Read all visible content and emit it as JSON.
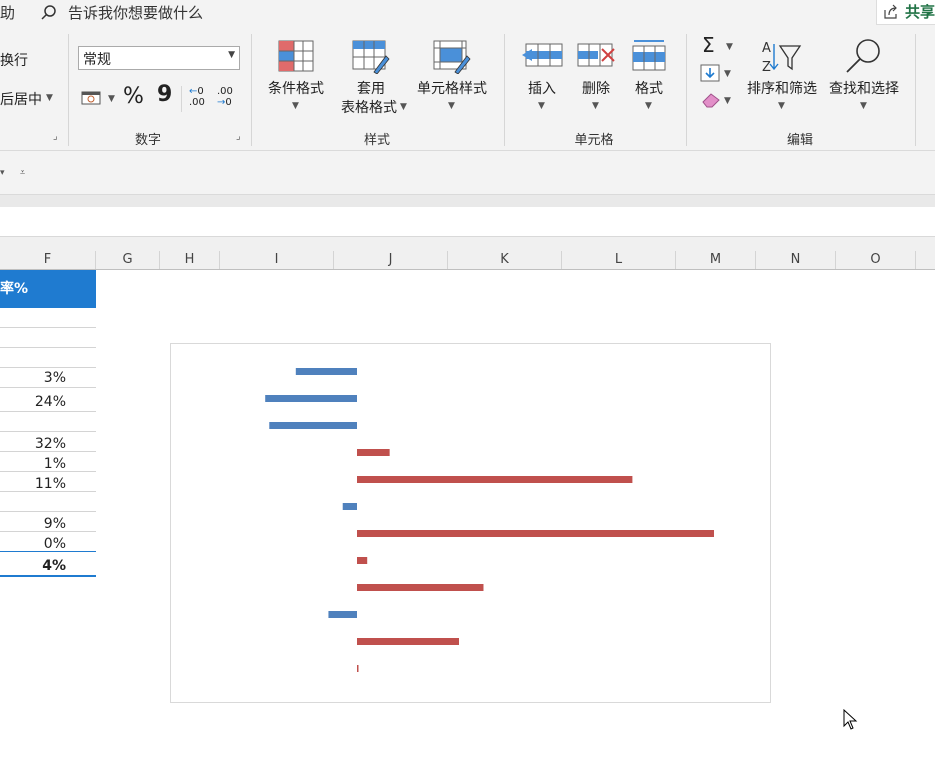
{
  "ribbon": {
    "tell_me": "告诉我你想要做什么",
    "cut_tab_text": "助",
    "share": "共享",
    "alignment": {
      "wrap": "换行",
      "merge": "后居中"
    },
    "number": {
      "format": "常规",
      "percent": "%",
      "comma": "9",
      "inc_decimal": ".00",
      "dec_decimal": ".00",
      "group": "数字"
    },
    "styles": {
      "conditional": "条件格式",
      "table_l1": "套用",
      "table_l2": "表格格式",
      "cell_styles": "单元格样式",
      "group": "样式"
    },
    "cells": {
      "insert": "插入",
      "delete": "删除",
      "format": "格式",
      "group": "单元格"
    },
    "editing": {
      "sum": "Σ",
      "sort_filter": "排序和筛选",
      "find_select": "查找和选择",
      "group": "编辑"
    }
  },
  "columns": [
    "F",
    "G",
    "H",
    "I",
    "J",
    "K",
    "L",
    "M",
    "N",
    "O"
  ],
  "sheet": {
    "header_cell": "率%",
    "values": [
      "3%",
      "24%",
      "32%",
      "1%",
      "11%",
      "9%",
      "0%"
    ],
    "total": "4%"
  },
  "colors": {
    "accent": "#1f7bd0",
    "negative_bar": "#4f81bd",
    "positive_bar": "#c0504d"
  },
  "chart_data": {
    "type": "bar",
    "orientation": "horizontal",
    "values": [
      -0.3,
      -0.45,
      -0.43,
      0.16,
      1.35,
      -0.07,
      1.75,
      0.05,
      0.62,
      -0.14,
      0.5,
      0.005
    ],
    "xlim": [
      -1.0,
      2.0
    ],
    "grid": false,
    "legend": "none",
    "title": ""
  }
}
